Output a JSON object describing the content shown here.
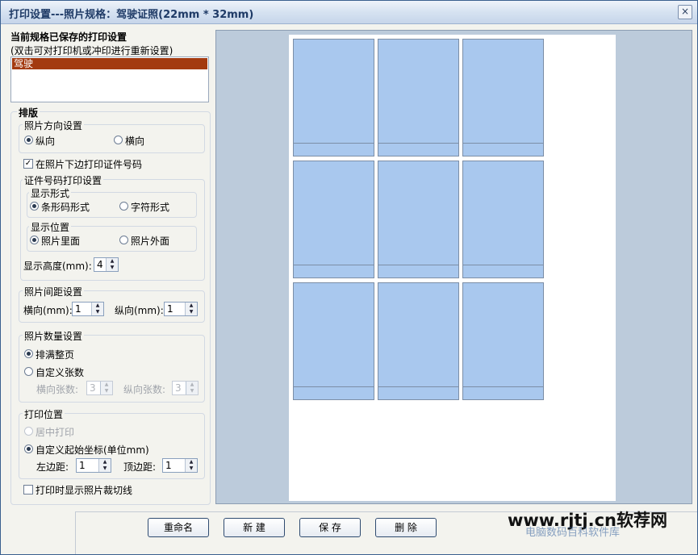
{
  "window": {
    "title": "打印设置---照片规格：驾驶证照(22mm * 32mm)",
    "close": "×"
  },
  "saved": {
    "title": "当前规格已保存的打印设置",
    "hint": "(双击可对打印机或冲印进行重新设置)",
    "items": [
      "驾驶"
    ]
  },
  "layout": {
    "title": "排版",
    "orientation": {
      "title": "照片方向设置",
      "portrait": "纵向",
      "landscape": "横向"
    },
    "print_id_label": "在照片下边打印证件号码",
    "id_settings": {
      "title": "证件号码打印设置",
      "display_form": {
        "title": "显示形式",
        "barcode": "条形码形式",
        "text": "字符形式"
      },
      "display_position": {
        "title": "显示位置",
        "inside": "照片里面",
        "outside": "照片外面"
      },
      "height_label": "显示高度(mm):",
      "height_value": "4"
    },
    "spacing": {
      "title": "照片间距设置",
      "h_label": "横向(mm):",
      "h_value": "1",
      "v_label": "纵向(mm):",
      "v_value": "1"
    },
    "count": {
      "title": "照片数量设置",
      "fill_page": "排满整页",
      "custom": "自定义张数",
      "h_label": "横向张数:",
      "h_value": "3",
      "v_label": "纵向张数:",
      "v_value": "3"
    },
    "position": {
      "title": "打印位置",
      "center": "居中打印",
      "custom": "自定义起始坐标(单位mm)",
      "left_label": "左边距:",
      "left_value": "1",
      "top_label": "顶边距:",
      "top_value": "1"
    },
    "cutline_label": "打印时显示照片裁切线"
  },
  "buttons": {
    "rename": "重命名",
    "new": "新  建",
    "save": "保  存",
    "delete": "删  除"
  },
  "watermark": {
    "main": "www.rjtj.cn软荐网",
    "sub": "电脑数码百科软件库"
  },
  "colors": {
    "photo": "#a9c8ee",
    "selected": "#a33a10",
    "preview_bg": "#bccbdb"
  }
}
